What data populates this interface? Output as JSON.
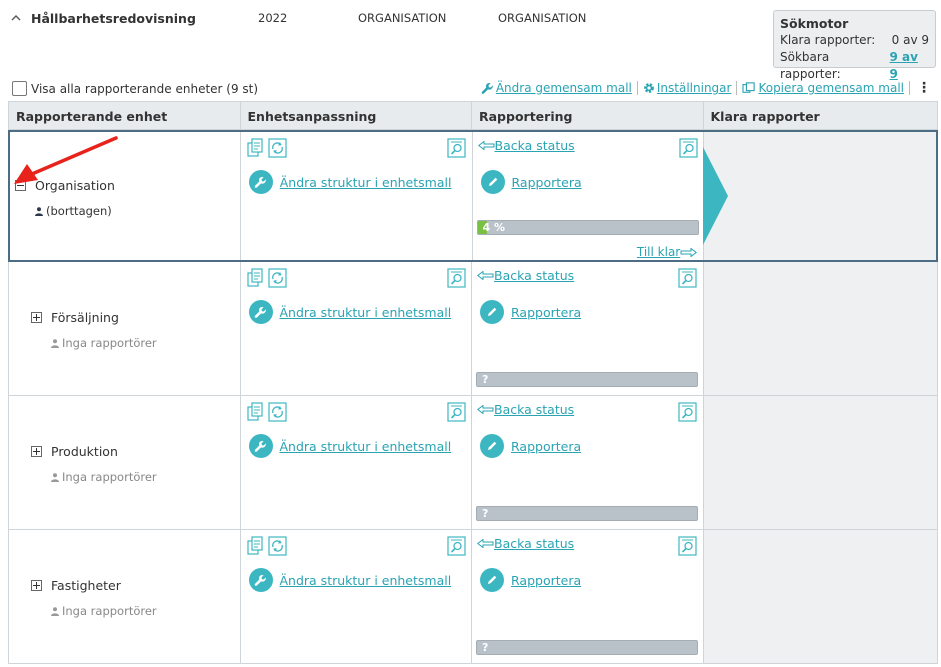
{
  "header": {
    "title": "Hållbarhetsredovisning",
    "year": "2022",
    "org_col1": "ORGANISATION",
    "org_col2": "ORGANISATION"
  },
  "search_engine": {
    "title": "Sökmotor",
    "finished_label": "Klara rapporter:",
    "finished_value": "0 av 9",
    "searchable_label": "Sökbara rapporter:",
    "searchable_value": "9 av 9"
  },
  "toolbar": {
    "show_all_label": "Visa alla rapporterande enheter (9 st)",
    "change_template": "Ändra gemensam mall",
    "settings": "Inställningar",
    "copy_template": "Kopiera gemensam mall"
  },
  "columns": [
    "Rapporterande enhet",
    "Enhetsanpassning",
    "Rapportering",
    "Klara rapporter"
  ],
  "rows": [
    {
      "unit": "Organisation",
      "reporter": "(borttagen)",
      "reporter_muted": false,
      "expanded": true,
      "change_structure": "Ändra struktur i enhetsmall",
      "back_status": "Backa status",
      "report": "Rapportera",
      "progress_label": "4 %",
      "progress_fraction": 0.04,
      "till_klar": "Till klar"
    },
    {
      "unit": "Försäljning",
      "reporter": "Inga rapportörer",
      "reporter_muted": true,
      "expanded": false,
      "change_structure": "Ändra struktur i enhetsmall",
      "back_status": "Backa status",
      "report": "Rapportera",
      "progress_label": "?",
      "progress_fraction": 0
    },
    {
      "unit": "Produktion",
      "reporter": "Inga rapportörer",
      "reporter_muted": true,
      "expanded": false,
      "change_structure": "Ändra struktur i enhetsmall",
      "back_status": "Backa status",
      "report": "Rapportera",
      "progress_label": "?",
      "progress_fraction": 0
    },
    {
      "unit": "Fastigheter",
      "reporter": "Inga rapportörer",
      "reporter_muted": true,
      "expanded": false,
      "change_structure": "Ändra struktur i enhetsmall",
      "back_status": "Backa status",
      "report": "Rapportera",
      "progress_label": "?",
      "progress_fraction": 0
    }
  ],
  "colors": {
    "accent": "#3cb7c2",
    "link": "#2aa3b3",
    "progress_fill": "#79c142",
    "progress_bg": "#b9c1c9",
    "selected_border": "#4d6d84",
    "annotation_arrow": "#e8231c"
  }
}
